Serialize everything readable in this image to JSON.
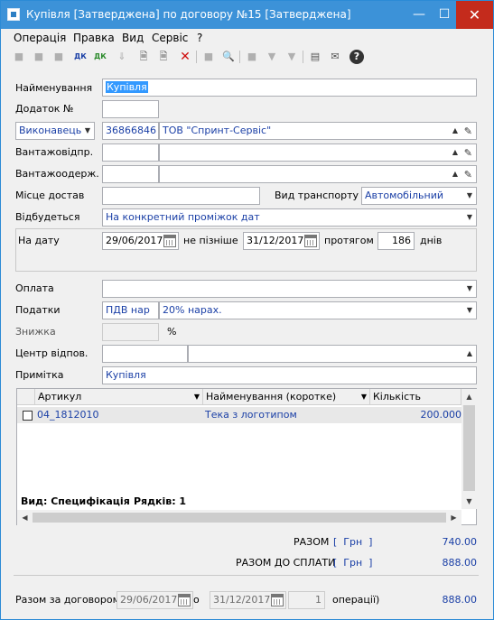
{
  "window": {
    "title": "Купівля [Затверджена] по договору №15 [Затверджена]"
  },
  "menu": [
    "Операція",
    "Правка",
    "Вид",
    "Сервіс",
    "?"
  ],
  "toolbar": {
    "dk1": "ДК",
    "dk2": "ДК"
  },
  "form": {
    "name_label": "Найменування",
    "name_value": "Купівля",
    "addendum_label": "Додаток №",
    "addendum_value": "",
    "executor_label": "Виконавець",
    "executor_code": "36866846",
    "executor_name": "ТОВ \"Спринт-Сервіс\"",
    "shipper_label": "Вантажовідпр.",
    "shipper_code": "",
    "shipper_name": "",
    "consignee_label": "Вантажоодерж.",
    "consignee_code": "",
    "consignee_name": "",
    "delivery_place_label": "Місце достав",
    "delivery_place_value": "",
    "transport_label": "Вид транспорту",
    "transport_value": "Автомобільний",
    "occurs_label": "Відбудеться",
    "occurs_value": "На конкретний проміжок дат",
    "date_label": "На дату",
    "date_value": "29/06/2017",
    "not_later_label": "не пізніше",
    "not_later_value": "31/12/2017",
    "during_label": "протягом",
    "during_value": "186",
    "days_label": "днів",
    "payment_label": "Оплата",
    "payment_value": "",
    "taxes_label": "Податки",
    "taxes_code": "ПДВ нар",
    "taxes_value": "20% нарах.",
    "discount_label": "Знижка",
    "discount_value": "",
    "percent_sign": "%",
    "resp_center_label": "Центр відпов.",
    "resp_center_code": "",
    "resp_center_value": "",
    "note_label": "Примітка",
    "note_value": "Купівля"
  },
  "grid": {
    "columns": [
      "Артикул",
      "Найменування (коротке)",
      "Кількість"
    ],
    "rows": [
      {
        "article": "04_1812010",
        "name": "Тека з логотипом",
        "qty": "200.000"
      }
    ],
    "footer_view": "Вид: Специфікація",
    "footer_rows": "Рядків: 1"
  },
  "totals": {
    "total_label": "РАЗОМ",
    "total_currency": "[  Грн  ]",
    "total_value": "740.00",
    "topay_label": "РАЗОМ ДО СПЛАТИ",
    "topay_currency": "[  Грн  ]",
    "topay_value": "888.00"
  },
  "contract": {
    "label": "Разом за договором з",
    "from": "29/06/2017",
    "to_label": "о",
    "to": "31/12/2017",
    "count": "1",
    "ops_label": "операції)",
    "value": "888.00"
  }
}
